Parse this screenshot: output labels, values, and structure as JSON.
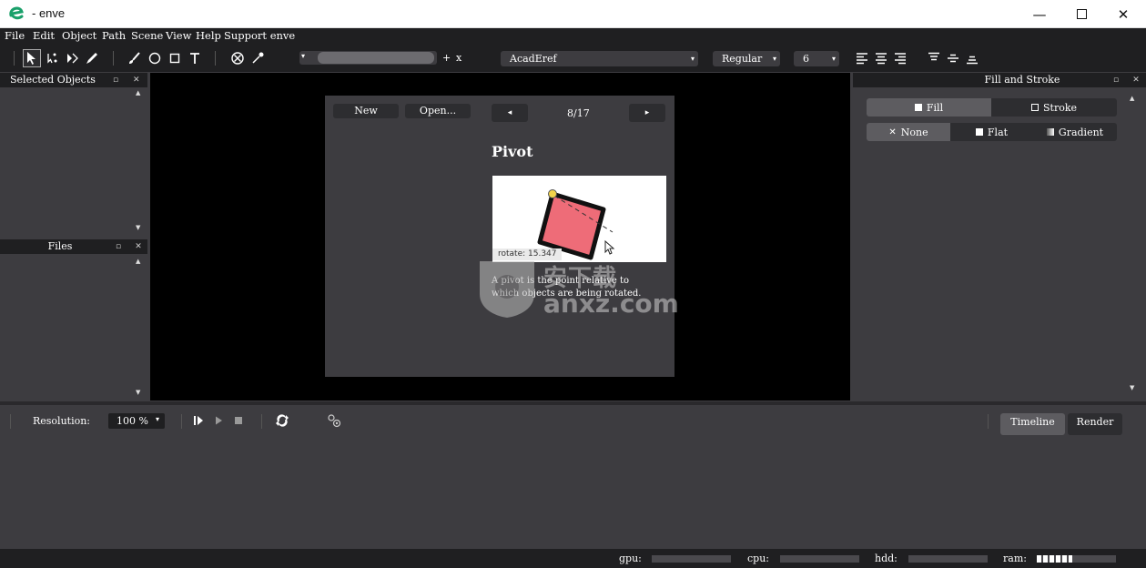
{
  "window": {
    "title": "- enve",
    "minimize_icon": "minimize-icon",
    "maximize_icon": "maximize-icon",
    "close_icon": "close-icon"
  },
  "menu": [
    "File",
    "Edit",
    "Object",
    "Path",
    "Scene",
    "View",
    "Help",
    "Support enve"
  ],
  "toolbar": {
    "tools": [
      "select-arrow-icon",
      "point-select-icon",
      "node-icon",
      "draw-path-icon",
      "paint-brush-icon",
      "circle-icon",
      "rectangle-icon",
      "text-icon",
      "no-color-icon",
      "color-picker-icon"
    ],
    "plus_label": "+",
    "x_label": "x",
    "font_family": "AcadEref",
    "font_style": "Regular",
    "font_size": "6",
    "align_icons": [
      "align-left-icon",
      "align-center-icon",
      "align-right-icon",
      "align-top-icon",
      "align-vcenter-icon",
      "align-bottom-icon"
    ]
  },
  "panels": {
    "selected_objects": {
      "title": "Selected Objects"
    },
    "files": {
      "title": "Files"
    },
    "fill_stroke": {
      "title": "Fill and Stroke",
      "tabs": [
        "Fill",
        "Stroke"
      ],
      "paint_types": [
        "None",
        "Flat",
        "Gradient"
      ]
    }
  },
  "welcome": {
    "new_label": "New",
    "open_label": "Open...",
    "prev_icon": "◂",
    "next_icon": "▸",
    "page": "8/17",
    "heading": "Pivot",
    "tooltip": "rotate: 15.347",
    "description_line1": "A pivot is the point relative to",
    "description_line2": "which objects are being rotated."
  },
  "watermark": {
    "text": "anxz.com",
    "cn_text": "安下载"
  },
  "bottom": {
    "resolution_label": "Resolution:",
    "resolution_value": "100 %",
    "tabs": [
      "Timeline",
      "Render"
    ]
  },
  "status": {
    "gpu": "gpu:",
    "cpu": "cpu:",
    "hdd": "hdd:",
    "ram": "ram:",
    "ram_fill": 0.45
  },
  "colors": {
    "accent_bg": "#3d3c40",
    "dark_bg": "#1f1f21",
    "canvas": "#000000",
    "pivot_rect": "#ee6c78"
  }
}
